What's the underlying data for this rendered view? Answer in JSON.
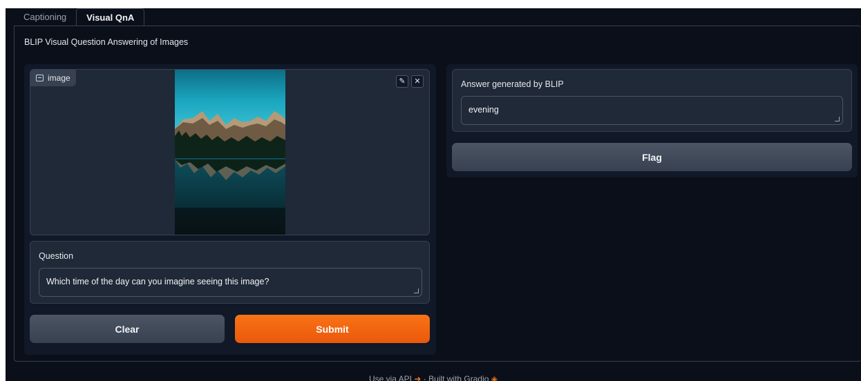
{
  "tabs": [
    {
      "label": "Captioning",
      "active": false
    },
    {
      "label": "Visual QnA",
      "active": true
    }
  ],
  "description": "BLIP Visual Question Answering of Images",
  "image_input": {
    "label": "image",
    "tools": {
      "edit_icon": "pencil-icon",
      "clear_icon": "close-icon"
    }
  },
  "question": {
    "label": "Question",
    "value": "Which time of the day can you imagine seeing this image?"
  },
  "buttons": {
    "clear": "Clear",
    "submit": "Submit",
    "flag": "Flag"
  },
  "answer": {
    "label": "Answer generated by BLIP",
    "value": "evening"
  },
  "footer": {
    "api": "Use via API",
    "separator": "·",
    "built": "Built with Gradio"
  },
  "colors": {
    "background": "#0b0f19",
    "panel": "#111827",
    "accent": "#f97316"
  }
}
